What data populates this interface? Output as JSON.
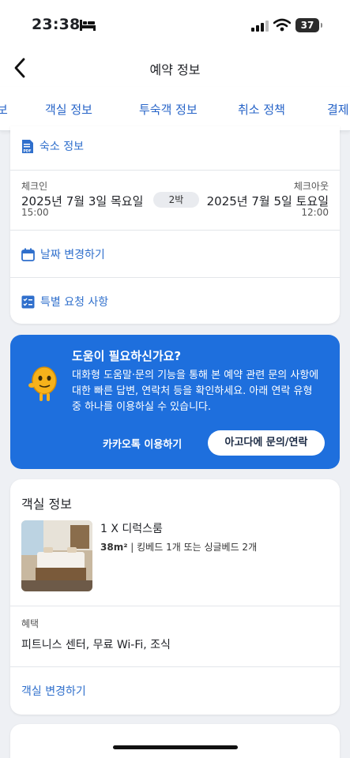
{
  "status": {
    "time": "23:38",
    "battery": "37"
  },
  "header": {
    "title": "예약 정보",
    "back_icon": "chevron-left-icon"
  },
  "tabs": [
    {
      "label": "보"
    },
    {
      "label": "객실 정보",
      "active": true
    },
    {
      "label": "투숙객 정보"
    },
    {
      "label": "취소 정책"
    },
    {
      "label": "결제"
    }
  ],
  "stay_card": {
    "property_info_link": "숙소 정보",
    "checkin_label": "체크인",
    "checkin_date": "2025년 7월 3일 목요일",
    "checkin_time": "15:00",
    "nights": "2박",
    "checkout_label": "체크아웃",
    "checkout_date": "2025년 7월 5일 토요일",
    "checkout_time": "12:00",
    "change_date_link": "날짜 변경하기",
    "special_request_link": "특별 요청 사항"
  },
  "help_banner": {
    "title": "도움이 필요하신가요?",
    "body": "대화형 도움말·문의 기능을 통해 본 예약 관련 문의 사항에 대한 빠른 답변, 연락처 등을 확인하세요. 아래 연락 유형 중 하나를 이용하실 수 있습니다.",
    "kakao_button": "카카오톡 이용하기",
    "contact_button": "아고다에 문의/연락",
    "bg_color": "#1e6fdd"
  },
  "room_card": {
    "title": "객실 정보",
    "room_name": "1 X 디럭스룸",
    "room_size": "38m²",
    "room_bed": "킹베드 1개 또는 싱글베드 2개",
    "benefits_label": "혜택",
    "benefits": "피트니스 센터, 무료 Wi-Fi, 조식",
    "change_room_link": "객실 변경하기"
  },
  "accent_color": "#2764c8"
}
